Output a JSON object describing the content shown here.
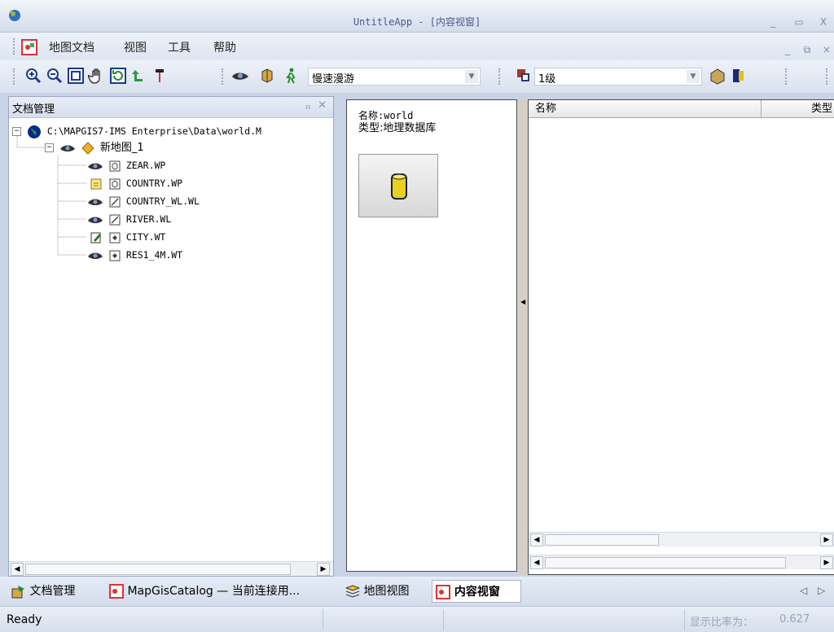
{
  "window": {
    "title": "UntitleApp - [内容视窗]"
  },
  "menu": {
    "items": [
      "地图文档",
      "视图",
      "工具",
      "帮助"
    ]
  },
  "toolbar": {
    "roam_mode": "慢速漫游",
    "level": "1级"
  },
  "left_panel": {
    "title": "文档管理",
    "tree": {
      "root": "C:\\MAPGIS7-IMS Enterprise\\Data\\world.M",
      "map": "新地图_1",
      "layers": [
        "ZEAR.WP",
        "COUNTRY.WP",
        "COUNTRY_WL.WL",
        "RIVER.WL",
        "CITY.WT",
        "RES1_4M.WT"
      ]
    }
  },
  "info": {
    "name_line": "名称:world",
    "type_line": "类型:地理数据库"
  },
  "list": {
    "columns": [
      "名称",
      "类型"
    ]
  },
  "bottom_tabs": {
    "left": [
      "文档管理",
      "MapGisCatalog — 当前连接用..."
    ],
    "right": [
      "地图视图",
      "内容视窗"
    ]
  },
  "status": {
    "ready": "Ready",
    "scale_label": "显示比率为：",
    "scale_value": "0.627"
  }
}
